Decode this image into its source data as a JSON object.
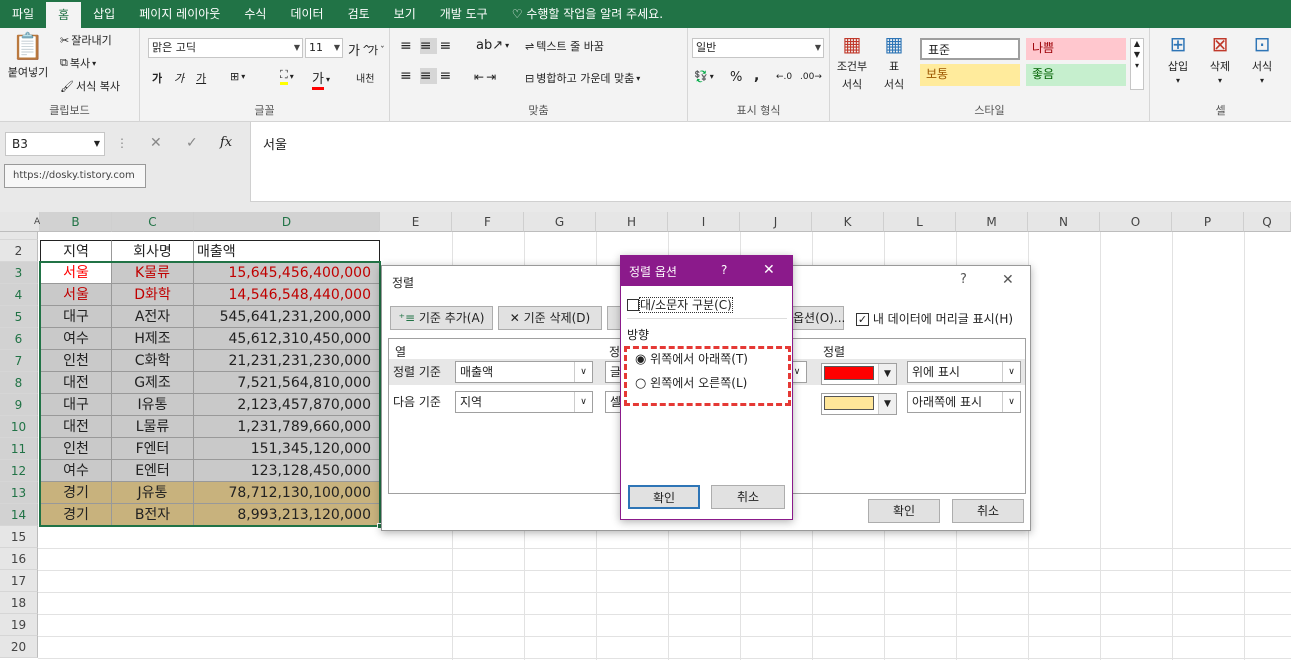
{
  "tabs": [
    "파일",
    "홈",
    "삽입",
    "페이지 레이아웃",
    "수식",
    "데이터",
    "검토",
    "보기",
    "개발 도구"
  ],
  "tell_me": "수행할 작업을 알려 주세요.",
  "ribbon": {
    "clipboard": {
      "paste": "붙여넣기",
      "cut": "잘라내기",
      "copy": "복사",
      "format_painter": "서식 복사",
      "name": "클립보드"
    },
    "font": {
      "family": "맑은 고딕",
      "size": "11",
      "bold": "가",
      "italic": "가",
      "underline": "가",
      "grow": "가",
      "shrink": "가",
      "color_label": "가",
      "phonetic": "내천",
      "name": "글꼴"
    },
    "alignment": {
      "wrap": "텍스트 줄 바꿈",
      "merge": "병합하고 가운데 맞춤",
      "name": "맞춤"
    },
    "number": {
      "format": "일반",
      "percent": "%",
      "comma": ",",
      "name": "표시 형식"
    },
    "styles": {
      "cond_format": "조건부",
      "cond_format2": "서식",
      "table_format": "표",
      "table_format2": "서식",
      "normal": "표준",
      "bad": "나쁨",
      "neutral": "보통",
      "good": "좋음",
      "name": "스타일"
    },
    "cells": {
      "insert": "삽입",
      "delete": "삭제",
      "format": "서식",
      "name": "셀"
    }
  },
  "namebox": "B3",
  "formula_value": "서울",
  "fx": "fx",
  "url_tip": "https://dosky.tistory.com",
  "columns": [
    "A",
    "B",
    "C",
    "D",
    "E",
    "F",
    "G",
    "H",
    "I",
    "J",
    "K",
    "L",
    "M",
    "N",
    "O",
    "P",
    "Q"
  ],
  "rows": [
    "2",
    "3",
    "4",
    "5",
    "6",
    "7",
    "8",
    "9",
    "10",
    "11",
    "12",
    "13",
    "14",
    "15",
    "16",
    "17",
    "18",
    "19",
    "20"
  ],
  "table": {
    "headers": [
      "지역",
      "회사명",
      "매출액"
    ],
    "data": [
      [
        "서울",
        "K물류",
        "15,645,456,400,000"
      ],
      [
        "서울",
        "D화학",
        "14,546,548,440,000"
      ],
      [
        "대구",
        "A전자",
        "545,641,231,200,000"
      ],
      [
        "여수",
        "H제조",
        "45,612,310,450,000"
      ],
      [
        "인천",
        "C화학",
        "21,231,231,230,000"
      ],
      [
        "대전",
        "G제조",
        "7,521,564,810,000"
      ],
      [
        "대구",
        "I유통",
        "2,123,457,870,000"
      ],
      [
        "대전",
        "L물류",
        "1,231,789,660,000"
      ],
      [
        "인천",
        "F엔터",
        "151,345,120,000"
      ],
      [
        "여수",
        "E엔터",
        "123,128,450,000"
      ],
      [
        "경기",
        "J유통",
        "78,712,130,100,000"
      ],
      [
        "경기",
        "B전자",
        "8,993,213,120,000"
      ]
    ]
  },
  "sort_dialog": {
    "title": "정렬",
    "help": "?",
    "close": "✕",
    "add_level": "기준 추가(A)",
    "delete_level": "기준 삭제(D)",
    "options": "옵션(O)...",
    "headers_check": "내 데이터에 머리글 표시(H)",
    "col_header": "열",
    "sort_on_header": "정",
    "order_header": "정렬",
    "row1_label": "정렬 기준",
    "row1_col": "매출액",
    "row1_sorton": "글",
    "row1_order": "위에 표시",
    "row2_label": "다음 기준",
    "row2_col": "지역",
    "row2_sorton": "셀",
    "row2_order": "아래쪽에 표시",
    "ok": "확인",
    "cancel": "취소"
  },
  "options_dialog": {
    "title": "정렬 옵션",
    "help": "?",
    "close": "✕",
    "case": "대/소문자 구분(C)",
    "direction": "방향",
    "top_bottom": "위쪽에서 아래쪽(T)",
    "left_right": "왼쪽에서 오른쪽(L)",
    "ok": "확인",
    "cancel": "취소"
  },
  "colors": {
    "excel_green": "#217346",
    "red_fill": "#ff0000",
    "yellow_fill": "#ffe699",
    "gray_fill": "#c9c9c9",
    "tan_fill": "#c8b27d",
    "dialog_purple": "#8b1a8b",
    "highlight_red": "#e53935"
  }
}
